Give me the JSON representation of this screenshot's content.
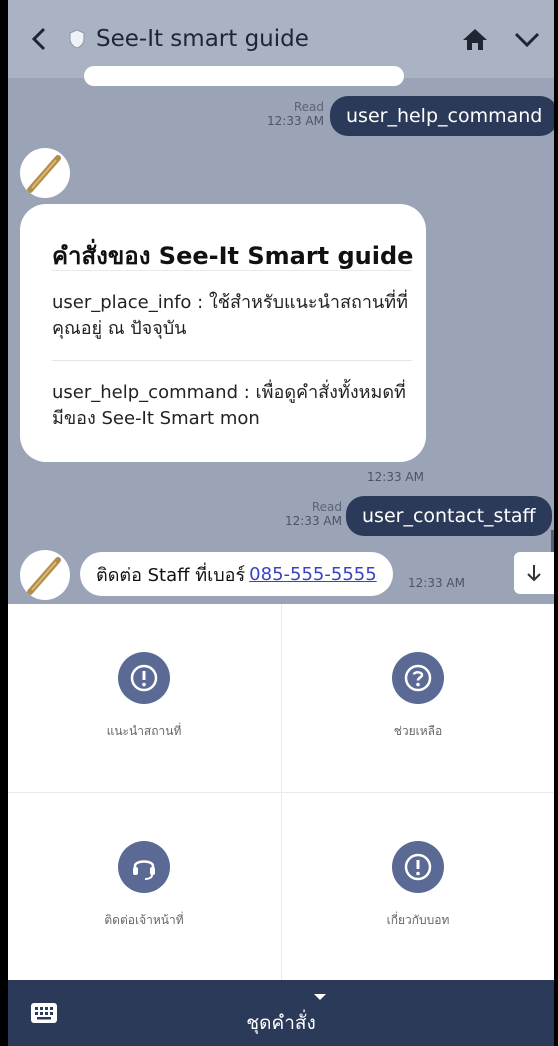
{
  "header": {
    "title": "See-It smart guide",
    "icons": [
      "back-icon",
      "shield-icon",
      "home-icon",
      "chevron-down-icon"
    ]
  },
  "messages": {
    "help_cmd": {
      "status": "Read",
      "time": "12:33 AM",
      "text": "user_help_command"
    },
    "card": {
      "title": "คำสั่งของ See-It Smart guide",
      "item1": "user_place_info : ใช้สำหรับแนะนำสถานที่ที่คุณอยู่ ณ ปัจจุบัน",
      "item2": "user_help_command : เพื่อดูคำสั่งทั้งหมดที่มีของ See-It Smart mon",
      "time": "12:33 AM"
    },
    "contact_staff": {
      "status": "Read",
      "time": "12:33 AM",
      "text": "user_contact_staff"
    },
    "reply": {
      "text": "ติดต่อ Staff ที่เบอร์",
      "phone": "085-555-5555",
      "time": "12:33 AM"
    }
  },
  "rich_menu": {
    "items": [
      {
        "label": "แนะนำสถานที่",
        "icon": "exclamation-circle-icon"
      },
      {
        "label": "ช่วยเหลือ",
        "icon": "question-circle-icon"
      },
      {
        "label": "ติดต่อเจ้าหน้าที่",
        "icon": "headset-icon"
      },
      {
        "label": "เกี่ยวกับบอท",
        "icon": "exclamation-circle-icon"
      }
    ]
  },
  "bottom_bar": {
    "label": "ชุดคำสั่ง",
    "icons": [
      "keyboard-icon",
      "caret-down-icon"
    ]
  },
  "colors": {
    "header_bg": "#aab3c3",
    "chat_bg": "#9aa4b6",
    "bubble_out": "#2c3a59",
    "icon_circle": "#5a6a94",
    "link": "#3a43c6"
  }
}
